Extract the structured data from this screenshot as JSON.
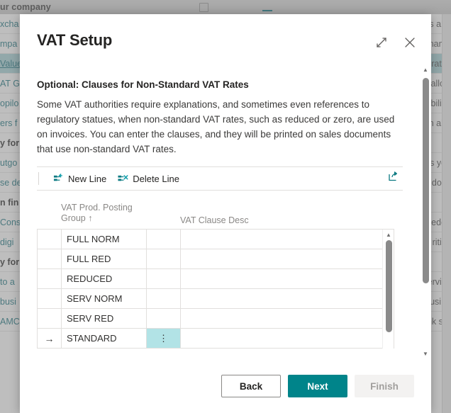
{
  "background": {
    "topbar_title": "ur company",
    "rows": [
      {
        "left": "xcha",
        "right": "es and",
        "left_style": "link",
        "right_style": "plain",
        "highlight": false
      },
      {
        "left": "mpa",
        "right": "name",
        "left_style": "link",
        "right_style": "plain",
        "highlight": false
      },
      {
        "left": "Value",
        "right": "e rates",
        "left_style": "link-u",
        "right_style": "plain",
        "highlight": true
      },
      {
        "left": "AT G",
        "right": "allow",
        "left_style": "link",
        "right_style": "plain",
        "highlight": false
      },
      {
        "left": "opilo",
        "right": "bilitie",
        "left_style": "link",
        "right_style": "plain",
        "highlight": false
      },
      {
        "left": "ers f",
        "right": "n abo",
        "left_style": "link",
        "right_style": "plain",
        "highlight": false
      },
      {
        "left": "y for",
        "right": "",
        "left_style": "bold",
        "right_style": "plain",
        "highlight": false
      },
      {
        "left": "utgo",
        "right": "s you",
        "left_style": "link",
        "right_style": "plain",
        "highlight": false
      },
      {
        "left": "se de",
        "right": "docu",
        "left_style": "link",
        "right_style": "plain",
        "highlight": false
      },
      {
        "left": "n fin",
        "right": "",
        "left_style": "bold",
        "right_style": "plain",
        "highlight": false
      },
      {
        "left": "Cons",
        "right": "ledge",
        "left_style": "link",
        "right_style": "plain",
        "highlight": false
      },
      {
        "left": "digi",
        "right": "rities",
        "left_style": "link",
        "right_style": "plain",
        "highlight": false
      },
      {
        "left": "y for",
        "right": "",
        "left_style": "bold",
        "right_style": "plain",
        "highlight": false
      },
      {
        "left": "to a",
        "right": "ervice",
        "left_style": "link",
        "right_style": "plain",
        "highlight": false
      },
      {
        "left": "busi",
        "right": "usine",
        "left_style": "link",
        "right_style": "plain",
        "highlight": false
      },
      {
        "left": "AMC",
        "right": "nk ser",
        "left_style": "link",
        "right_style": "plain",
        "highlight": false
      }
    ]
  },
  "modal": {
    "title": "VAT Setup",
    "expand_icon": "expand-icon",
    "close_icon": "close-icon",
    "section_heading": "Optional: Clauses for Non-Standard VAT Rates",
    "section_text": "Some VAT authorities require explanations, and sometimes even references to regulatory statues, when non-standard VAT rates, such as reduced or zero, are used on invoices. You can enter the clauses, and they will be printed on sales documents that use non-standard VAT rates.",
    "toolbar": {
      "new_line_label": "New Line",
      "new_line_icon": "new-line-icon",
      "delete_line_label": "Delete Line",
      "delete_line_icon": "delete-line-icon",
      "share_icon": "open-in-excel-icon"
    },
    "table": {
      "columns": {
        "group": "VAT Prod. Posting Group",
        "group_sort": "↑",
        "description": "VAT Clause Desc"
      },
      "rows": [
        {
          "indicator": "",
          "group": "FULL NORM",
          "menu": "",
          "description": "",
          "selected": false
        },
        {
          "indicator": "",
          "group": "FULL RED",
          "menu": "",
          "description": "",
          "selected": false
        },
        {
          "indicator": "",
          "group": "REDUCED",
          "menu": "",
          "description": "",
          "selected": false
        },
        {
          "indicator": "",
          "group": "SERV NORM",
          "menu": "",
          "description": "",
          "selected": false
        },
        {
          "indicator": "",
          "group": "SERV RED",
          "menu": "",
          "description": "",
          "selected": false
        },
        {
          "indicator": "→",
          "group": "STANDARD",
          "menu": "⋮",
          "description": "",
          "selected": true
        }
      ]
    },
    "footer": {
      "back_label": "Back",
      "next_label": "Next",
      "finish_label": "Finish"
    }
  },
  "colors": {
    "accent_teal": "#00848a",
    "selection_cyan": "#b2e3e6",
    "bg_highlight": "#a8cfd4"
  }
}
